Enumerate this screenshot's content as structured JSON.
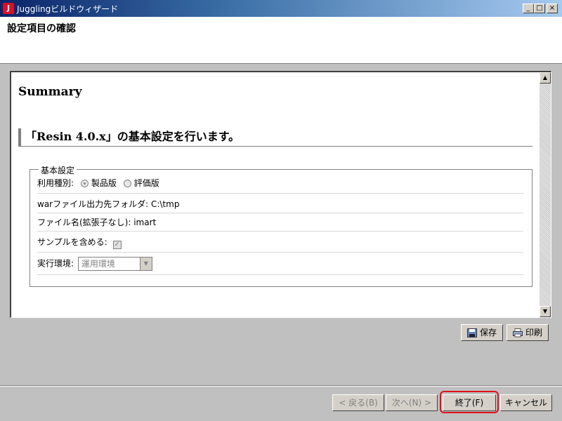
{
  "window": {
    "title": "JugglingビルドウィザードJ",
    "title_display": "Jugglingビルドウィザード",
    "controls": {
      "minimize": "_",
      "maximize": "□",
      "close": "×"
    }
  },
  "header": {
    "title": "設定項目の確認"
  },
  "content": {
    "summary_title": "Summary",
    "section_heading": "「Resin 4.0.x」の基本設定を行います。",
    "fieldset": {
      "legend": "基本設定",
      "usage_type_label": "利用種別:",
      "usage_options": [
        {
          "label": "製品版",
          "selected": true
        },
        {
          "label": "評価版",
          "selected": false
        }
      ],
      "war_output_folder": "warファイル出力先フォルダ: C:\\tmp",
      "file_name": "ファイル名(拡張子なし): imart",
      "include_sample_label": "サンプルを含める:",
      "include_sample_checked": true,
      "environment_label": "実行環境:",
      "environment_value": "運用環境"
    }
  },
  "actions": {
    "save_label": "保存",
    "print_label": "印刷"
  },
  "nav": {
    "back_label": "< 戻る(B)",
    "next_label": "次へ(N) >",
    "finish_label": "終了(F)",
    "cancel_label": "キャンセル"
  },
  "colors": {
    "highlight": "#e0101c",
    "titlebar_start": "#0a246a",
    "titlebar_end": "#a6caf0"
  },
  "icons": {
    "app": "juggling-app-icon",
    "save": "floppy-disk-icon",
    "print": "printer-icon"
  }
}
